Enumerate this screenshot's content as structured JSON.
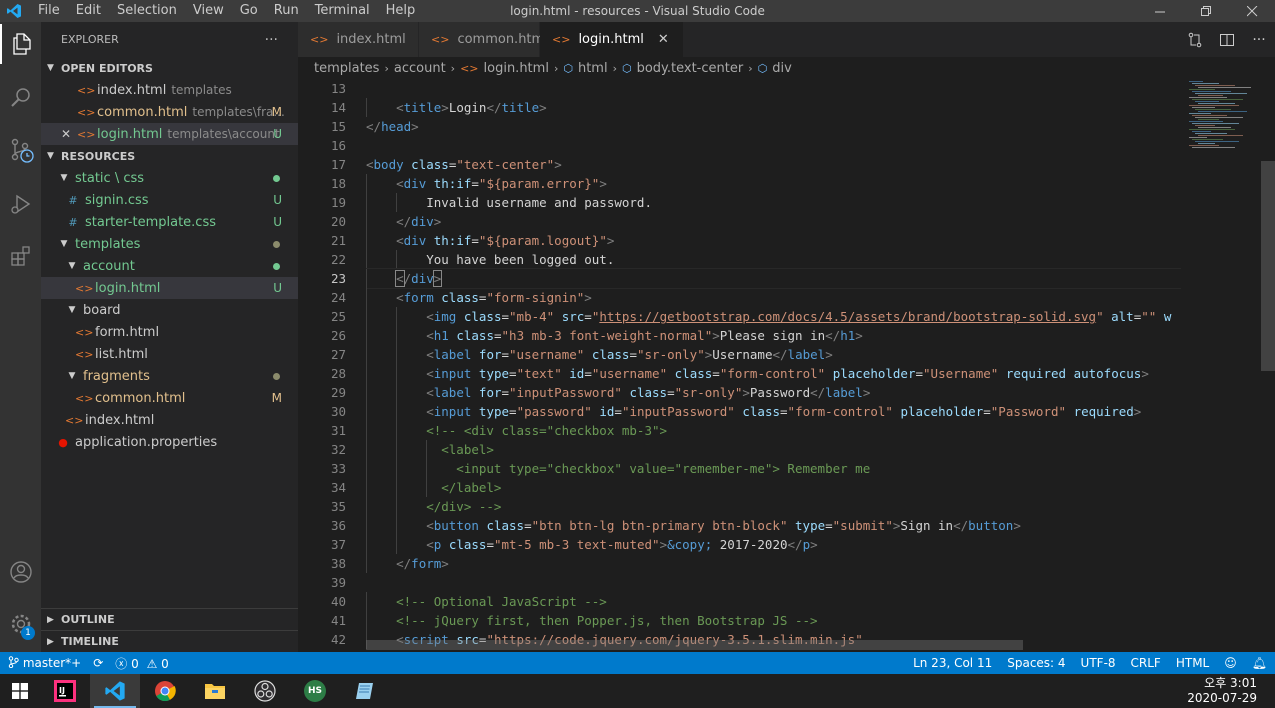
{
  "window": {
    "title": "login.html - resources - Visual Studio Code",
    "menu": [
      "File",
      "Edit",
      "Selection",
      "View",
      "Go",
      "Run",
      "Terminal",
      "Help"
    ]
  },
  "activity_bar": {
    "items": [
      "explorer-icon",
      "search-icon",
      "source-control-icon",
      "run-debug-icon",
      "extensions-icon"
    ],
    "bottom": [
      "account-icon",
      "settings-gear-icon"
    ],
    "settings_badge": "1"
  },
  "sidebar": {
    "title": "EXPLORER",
    "more": "···",
    "open_editors": {
      "label": "OPEN EDITORS",
      "items": [
        {
          "name": "index.html",
          "desc": "templates",
          "status": ""
        },
        {
          "name": "common.html",
          "desc": "templates\\fra...",
          "status": "M"
        },
        {
          "name": "login.html",
          "desc": "templates\\account",
          "status": "U"
        }
      ]
    },
    "resources": {
      "label": "RESOURCES",
      "static_css": "static \\ css",
      "signin": "signin.css",
      "starter": "starter-template.css",
      "templates": "templates",
      "account": "account",
      "login": "login.html",
      "board": "board",
      "form": "form.html",
      "list": "list.html",
      "fragments": "fragments",
      "common": "common.html",
      "index": "index.html",
      "application": "application.properties",
      "status_u": "U",
      "status_m": "M"
    },
    "outline": "OUTLINE",
    "timeline": "TIMELINE"
  },
  "tabs": [
    {
      "label": "index.html"
    },
    {
      "label": "common.html"
    },
    {
      "label": "login.html"
    }
  ],
  "tab_close": "✕",
  "breadcrumb": {
    "a": "templates",
    "b": "account",
    "c": "login.html",
    "d": "html",
    "e": "body.text-center",
    "f": "div"
  },
  "line_numbers": [
    "13",
    "14",
    "15",
    "16",
    "17",
    "18",
    "19",
    "20",
    "21",
    "22",
    "23",
    "24",
    "25",
    "26",
    "27",
    "28",
    "29",
    "30",
    "31",
    "32",
    "33",
    "34",
    "35",
    "36",
    "37",
    "38",
    "39",
    "40",
    "41",
    "42"
  ],
  "statusbar": {
    "branch": "master*+",
    "errors": "0",
    "warnings": "0",
    "position": "Ln 23, Col 11",
    "spaces": "Spaces: 4",
    "encoding": "UTF-8",
    "eol": "CRLF",
    "language": "HTML"
  },
  "taskbar": {
    "time": "오후 3:01",
    "date": "2020-07-29",
    "hs_label": "HS"
  },
  "colors": {
    "accent": "#007acc",
    "tag": "#569cd6",
    "attr": "#9cdcfe",
    "string": "#ce9178",
    "comment": "#6a9955",
    "modified": "#e2c08d",
    "untracked": "#73c991"
  }
}
